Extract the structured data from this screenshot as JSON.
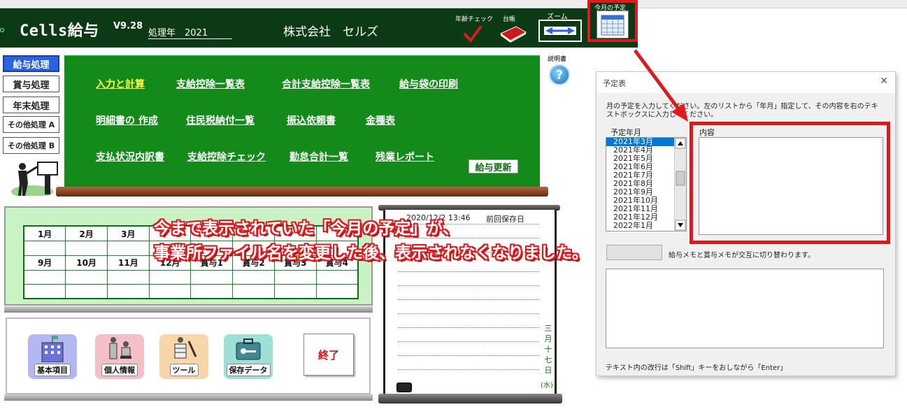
{
  "header": {
    "app_title": "Cells給与",
    "version": "V9.28",
    "year_label": "処理年　2021",
    "company": "株式会社　セルズ",
    "age_check_label": "年齢チェック",
    "ledger_label": "台帳",
    "zoom_label": "ズーム",
    "schedule_label": "今月の予定"
  },
  "sidebar": {
    "items": [
      {
        "label": "給与処理",
        "active": true
      },
      {
        "label": "賞与処理",
        "active": false
      },
      {
        "label": "年末処理",
        "active": false
      },
      {
        "label": "その他処理 A",
        "active": false
      },
      {
        "label": "その他処理 B",
        "active": false
      }
    ]
  },
  "board": {
    "links": [
      {
        "label": "入力と計算",
        "highlight": true
      },
      {
        "label": "支給控除一覧表"
      },
      {
        "label": "合計支給控除一覧表"
      },
      {
        "label": "給与袋の印刷"
      },
      {
        "label": "明細書の 作成"
      },
      {
        "label": "住民税納付一覧"
      },
      {
        "label": "振込依頼書"
      },
      {
        "label": "金種表"
      },
      {
        "label": "支払状況内訳書"
      },
      {
        "label": "支給控除チェック"
      },
      {
        "label": "勤怠合計一覧"
      },
      {
        "label": "残業レポート"
      }
    ],
    "salary_update": "給与更新"
  },
  "manual_label": "説明書",
  "months": {
    "row1": [
      "1月",
      "2月",
      "3月",
      "",
      "",
      "",
      "",
      ""
    ],
    "row3": [
      "9月",
      "10月",
      "11月",
      "12月",
      "賞与1",
      "賞与2",
      "賞与3",
      "賞与4"
    ]
  },
  "bottom_icons": [
    {
      "label": "基本項目"
    },
    {
      "label": "個人情報"
    },
    {
      "label": "ツール"
    },
    {
      "label": "保存データ"
    }
  ],
  "exit_label": "終了",
  "memo": {
    "save_date": "2020/12/2 13:46",
    "save_label": "前回保存日",
    "date_vertical": [
      "三",
      "月",
      "十",
      "七",
      "日"
    ],
    "day_of_week": "(水)"
  },
  "dialog": {
    "title": "予定表",
    "close": "✕",
    "instructions_a": "月の予定を入力してください。左のリストから「年月」指定して、その内容を右のテキ",
    "instructions_b": "ストボックスに入力してください。",
    "month_list_label": "予定年月",
    "months": [
      "2021年3月",
      "2021年4月",
      "2021年5月",
      "2021年6月",
      "2021年7月",
      "2021年8月",
      "2021年9月",
      "2021年10月",
      "2021年11月",
      "2021年12月",
      "2022年1月"
    ],
    "selected_month": "2021年3月",
    "content_label": "内容",
    "swap_note": "給与メモと賞与メモが交互に切り替わります。",
    "footer": "テキスト内の改行は「Shift」キーをおしながら「Enter」"
  },
  "callout": {
    "line1": "今まで表示されていた「今月の予定」が、",
    "line2": "事業所ファイル名を変更した後、表示されなくなりました。"
  },
  "colors": {
    "header_bg": "#0b3a14",
    "board_bg": "#138a1a",
    "accent_red": "#e0191e",
    "active_blue": "#2a62e0"
  }
}
